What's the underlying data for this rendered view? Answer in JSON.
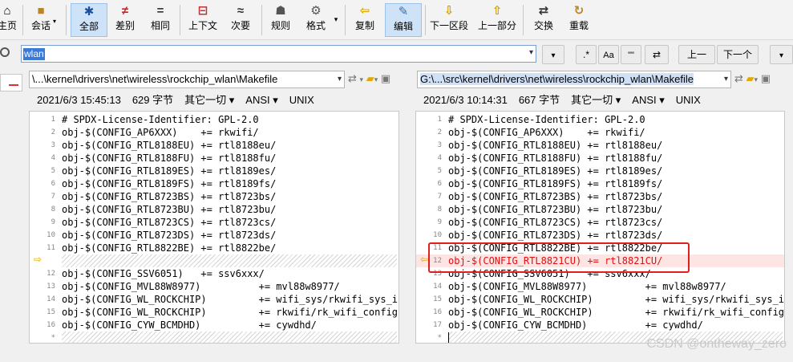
{
  "toolbar": {
    "buttons": [
      {
        "label": "主页",
        "icon": "home-icon",
        "glyph": "⌂"
      },
      {
        "label": "会话",
        "icon": "briefcase-icon",
        "glyph": "■"
      },
      {
        "label": "全部",
        "icon": "asterisk-icon",
        "glyph": "✱"
      },
      {
        "label": "差别",
        "icon": "not-equal-icon",
        "glyph": "≠"
      },
      {
        "label": "相同",
        "icon": "equal-icon",
        "glyph": "="
      },
      {
        "label": "上下文",
        "icon": "context-icon",
        "glyph": "⊟"
      },
      {
        "label": "次要",
        "icon": "approx-icon",
        "glyph": "≈"
      },
      {
        "label": "规则",
        "icon": "rules-icon",
        "glyph": "☗"
      },
      {
        "label": "格式",
        "icon": "format-icon",
        "glyph": "⚙"
      },
      {
        "label": "复制",
        "icon": "copy-left-icon",
        "glyph": "⇦"
      },
      {
        "label": "编辑",
        "icon": "edit-icon",
        "glyph": "✎"
      },
      {
        "label": "下一区段",
        "icon": "next-section-icon",
        "glyph": "⇩"
      },
      {
        "label": "上一部分",
        "icon": "prev-section-icon",
        "glyph": "⇧"
      },
      {
        "label": "交换",
        "icon": "swap-icon",
        "glyph": "⇄"
      },
      {
        "label": "重载",
        "icon": "reload-icon",
        "glyph": "↻"
      }
    ]
  },
  "search": {
    "value": "wlan",
    "regex_label": ".*",
    "case_label": "Aa",
    "word_label": "\"\"",
    "prev_label": "上一",
    "next_label": "下一个"
  },
  "left": {
    "path": "\\...\\kernel\\drivers\\net\\wireless\\rockchip_wlan\\Makefile",
    "date": "2021/6/3 15:45:13",
    "size": "629 字节",
    "other": "其它一切 ▾",
    "encoding": "ANSI ▾",
    "eol": "UNIX",
    "lines": [
      {
        "n": "1",
        "t": "# SPDX-License-Identifier: GPL-2.0"
      },
      {
        "n": "2",
        "t": "obj-$(CONFIG_AP6XXX)    += rkwifi/"
      },
      {
        "n": "3",
        "t": "obj-$(CONFIG_RTL8188EU) += rtl8188eu/"
      },
      {
        "n": "4",
        "t": "obj-$(CONFIG_RTL8188FU) += rtl8188fu/"
      },
      {
        "n": "5",
        "t": "obj-$(CONFIG_RTL8189ES) += rtl8189es/"
      },
      {
        "n": "6",
        "t": "obj-$(CONFIG_RTL8189FS) += rtl8189fs/"
      },
      {
        "n": "7",
        "t": "obj-$(CONFIG_RTL8723BS) += rtl8723bs/"
      },
      {
        "n": "8",
        "t": "obj-$(CONFIG_RTL8723BU) += rtl8723bu/"
      },
      {
        "n": "9",
        "t": "obj-$(CONFIG_RTL8723CS) += rtl8723cs/"
      },
      {
        "n": "10",
        "t": "obj-$(CONFIG_RTL8723DS) += rtl8723ds/"
      },
      {
        "n": "11",
        "t": "obj-$(CONFIG_RTL8822BE) += rtl8822be/"
      },
      {
        "n": "",
        "t": "",
        "gap": true
      },
      {
        "n": "12",
        "t": "obj-$(CONFIG_SSV6051)   += ssv6xxx/"
      },
      {
        "n": "13",
        "t": "obj-$(CONFIG_MVL88W8977)          += mvl88w8977/"
      },
      {
        "n": "14",
        "t": "obj-$(CONFIG_WL_ROCKCHIP)         += wifi_sys/rkwifi_sys_iface"
      },
      {
        "n": "15",
        "t": "obj-$(CONFIG_WL_ROCKCHIP)         += rkwifi/rk_wifi_config.o"
      },
      {
        "n": "16",
        "t": "obj-$(CONFIG_CYW_BCMDHD)          += cywdhd/"
      },
      {
        "n": "*",
        "t": "",
        "gap": true
      }
    ]
  },
  "right": {
    "path_prefix": "G:\\...\\src\\kernel\\drivers\\net\\wireless\\rockchip_wlan\\Makefile",
    "date": "2021/6/3 10:14:31",
    "size": "667 字节",
    "other": "其它一切 ▾",
    "encoding": "ANSI ▾",
    "eol": "UNIX",
    "lines": [
      {
        "n": "1",
        "t": "# SPDX-License-Identifier: GPL-2.0"
      },
      {
        "n": "2",
        "t": "obj-$(CONFIG_AP6XXX)    += rkwifi/"
      },
      {
        "n": "3",
        "t": "obj-$(CONFIG_RTL8188EU) += rtl8188eu/"
      },
      {
        "n": "4",
        "t": "obj-$(CONFIG_RTL8188FU) += rtl8188fu/"
      },
      {
        "n": "5",
        "t": "obj-$(CONFIG_RTL8189ES) += rtl8189es/"
      },
      {
        "n": "6",
        "t": "obj-$(CONFIG_RTL8189FS) += rtl8189fs/"
      },
      {
        "n": "7",
        "t": "obj-$(CONFIG_RTL8723BS) += rtl8723bs/"
      },
      {
        "n": "8",
        "t": "obj-$(CONFIG_RTL8723BU) += rtl8723bu/"
      },
      {
        "n": "9",
        "t": "obj-$(CONFIG_RTL8723CS) += rtl8723cs/"
      },
      {
        "n": "10",
        "t": "obj-$(CONFIG_RTL8723DS) += rtl8723ds/"
      },
      {
        "n": "11",
        "t": "obj-$(CONFIG_RTL8822BE) += rtl8822be/"
      },
      {
        "n": "12",
        "t": "obj-$(CONFIG_RTL8821CU) += rtl8821CU/",
        "diff": true
      },
      {
        "n": "13",
        "t": "obj-$(CONFIG_SSV6051)   += ssv6xxx/"
      },
      {
        "n": "14",
        "t": "obj-$(CONFIG_MVL88W8977)          += mvl88w8977/"
      },
      {
        "n": "15",
        "t": "obj-$(CONFIG_WL_ROCKCHIP)         += wifi_sys/rkwifi_sys_iface"
      },
      {
        "n": "16",
        "t": "obj-$(CONFIG_WL_ROCKCHIP)         += rkwifi/rk_wifi_config.o"
      },
      {
        "n": "17",
        "t": "obj-$(CONFIG_CYW_BCMDHD)          += cywdhd/"
      },
      {
        "n": "*",
        "t": "",
        "gap": true
      }
    ]
  },
  "watermark": "CSDN @ontheway_zero",
  "colors": {
    "diff_text": "#e01010",
    "diff_bg": "#ffe4e4",
    "highlight_box": "#e02020",
    "active_button": "#cfe3f8"
  }
}
